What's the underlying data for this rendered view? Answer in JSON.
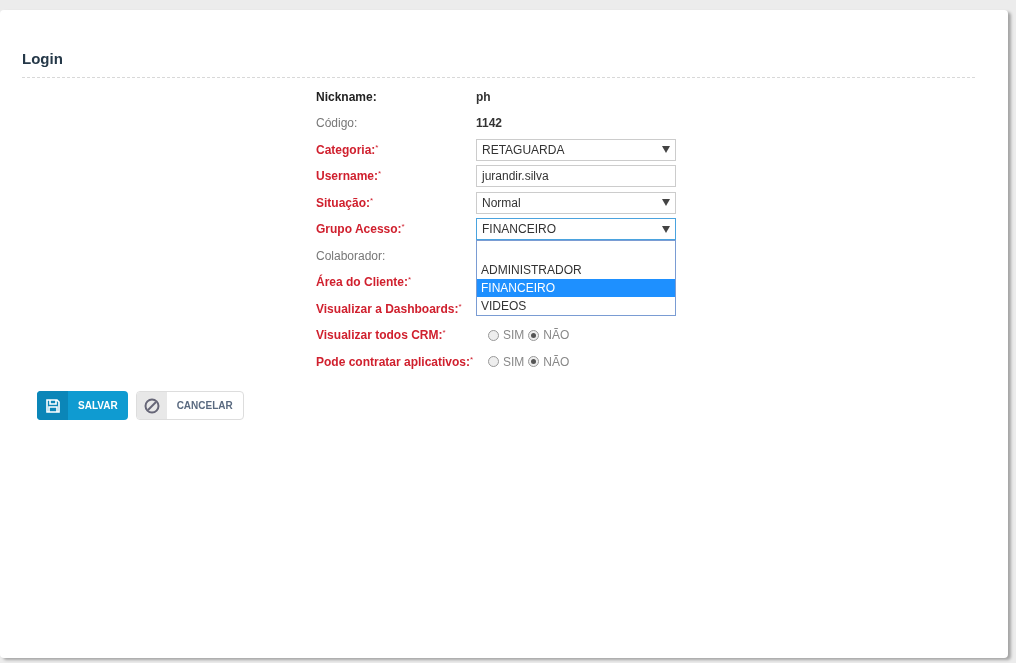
{
  "title": "Login",
  "fields": [
    {
      "kind": "text",
      "label": "Nickname:",
      "required": false,
      "bold": true,
      "value": "ph"
    },
    {
      "kind": "text",
      "label": "Código:",
      "required": false,
      "bold": false,
      "value": "1142"
    },
    {
      "kind": "select",
      "label": "Categoria:$^{*}$",
      "required": true,
      "value": "RETAGUARDA"
    },
    {
      "kind": "input",
      "label": "Username:$^{*}$",
      "required": true,
      "value": "jurandir.silva"
    },
    {
      "kind": "select",
      "label": "Situação:$^{*}$",
      "required": true,
      "value": "Normal"
    },
    {
      "kind": "select",
      "label": "Grupo Acesso:$^{*}$",
      "required": true,
      "value": "FINANCEIRO",
      "focused": true,
      "dropdown": [
        {
          "selected": false
        },
        {
          "label": "ADMINISTRADOR",
          "selected": false
        },
        {
          "label": "FINANCEIRO",
          "selected": true
        },
        {
          "label": "VIDEOS",
          "selected": false
        }
      ]
    },
    {
      "kind": "label",
      "label": "Colaborador:",
      "required": false,
      "bold": false
    },
    {
      "kind": "label",
      "label": "Área do Cliente:$^{*}$",
      "required": true
    },
    {
      "kind": "label",
      "label": "Visualizar a Dashboards:$^{*}$",
      "required": true
    },
    {
      "kind": "radio",
      "label": "Visualizar todos CRM:$^{*}$",
      "required": true,
      "options": [
        {
          "label": "SIM",
          "selected": false
        },
        {
          "label": "NÃO",
          "selected": true
        }
      ]
    },
    {
      "kind": "radio",
      "label": "Pode contratar aplicativos:$^{*}$",
      "required": true,
      "options": [
        {
          "label": "SIM",
          "selected": false
        },
        {
          "label": "NÃO",
          "selected": true
        }
      ]
    }
  ],
  "buttons": [
    {
      "kind": "save",
      "label": "SALVAR"
    },
    {
      "kind": "cancel",
      "label": "CANCELAR"
    }
  ]
}
